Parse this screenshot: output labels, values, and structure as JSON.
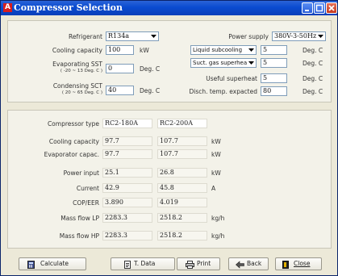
{
  "window": {
    "title": "Compressor Selection",
    "logo_letter": "A"
  },
  "inputs": {
    "refrigerant_label": "Refrigerant",
    "refrigerant_value": "R134a",
    "cooling_capacity_label": "Cooling capacity",
    "cooling_capacity_value": "100",
    "cooling_capacity_unit": "kW",
    "evap_sst_label": "Evaporating SST",
    "evap_sst_range": "( -20 ~ 13 Deg. C )",
    "evap_sst_value": "0",
    "evap_sst_unit": "Deg. C",
    "cond_sct_label": "Condensing SCT",
    "cond_sct_range": "( 20 ~ 65 Deg. C )",
    "cond_sct_value": "40",
    "cond_sct_unit": "Deg. C",
    "power_supply_label": "Power supply",
    "power_supply_value": "380V-3-50Hz",
    "subcooling_select": "Liquid subcooling",
    "subcooling_value": "5",
    "subcooling_unit": "Deg. C",
    "superheat_select": "Suct. gas superheat",
    "superheat_value": "5",
    "superheat_unit": "Deg. C",
    "useful_superheat_label": "Useful superheat",
    "useful_superheat_value": "5",
    "useful_superheat_unit": "Deg. C",
    "disch_temp_label": "Disch. temp. expacted",
    "disch_temp_value": "80",
    "disch_temp_unit": "Deg. C"
  },
  "results": {
    "compressor_type_label": "Compressor type",
    "models": [
      "RC2-180A",
      "RC2-200A"
    ],
    "rows": [
      {
        "label": "Cooling capacity",
        "v1": "97.7",
        "v2": "107.7",
        "unit": "kW"
      },
      {
        "label": "Evaporator capac.",
        "v1": "97.7",
        "v2": "107.7",
        "unit": "kW"
      },
      {
        "label": "Power input",
        "v1": "25.1",
        "v2": "26.8",
        "unit": "kW"
      },
      {
        "label": "Current",
        "v1": "42.9",
        "v2": "45.8",
        "unit": "A"
      },
      {
        "label": "COP/EER",
        "v1": "3.890",
        "v2": "4.019",
        "unit": ""
      },
      {
        "label": "Mass flow LP",
        "v1": "2283.3",
        "v2": "2518.2",
        "unit": "kg/h"
      },
      {
        "label": "Mass flow HP",
        "v1": "2283.3",
        "v2": "2518.2",
        "unit": "kg/h"
      }
    ]
  },
  "buttons": {
    "calculate": "Calculate",
    "tdata": "T. Data",
    "print": "Print",
    "back": "Back",
    "close": "Close"
  }
}
